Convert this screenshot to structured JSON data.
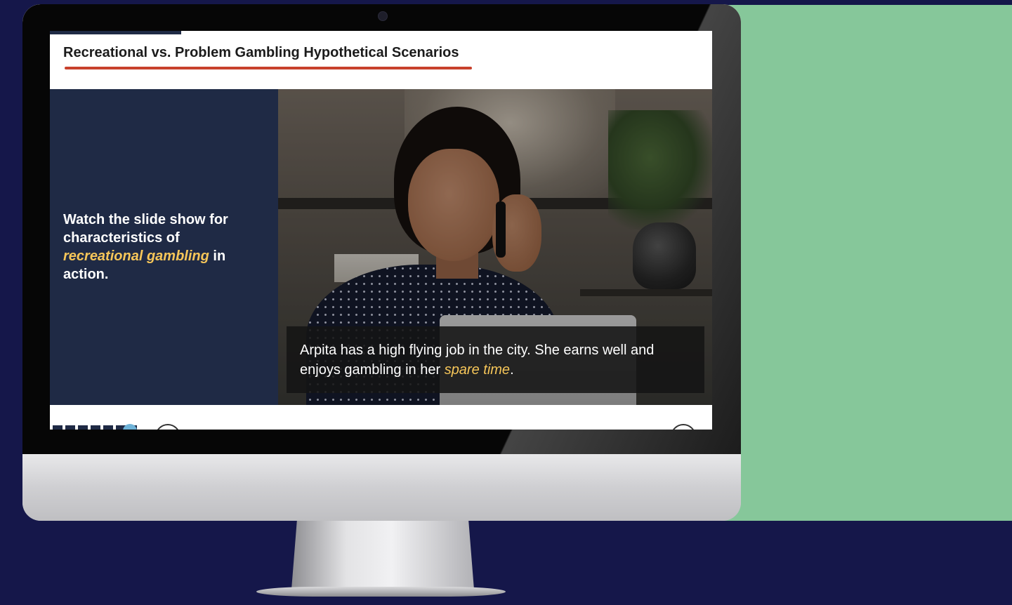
{
  "slide": {
    "title": "Recreational vs. Problem Gambling Hypothetical Scenarios",
    "instruction_part1": "Watch the slide show for characteristics of ",
    "instruction_highlight": "recreational gambling",
    "instruction_part2": " in action.",
    "caption_part1": "Arpita has a high flying job in the city. She earns well and enjoys gambling in her ",
    "caption_highlight": "spare time",
    "caption_part2": "."
  },
  "colors": {
    "accent_red": "#c8412c",
    "panel_navy": "#1f2a45",
    "highlight_yellow": "#f6c659",
    "background_navy": "#15174a",
    "side_green": "#86c79a"
  },
  "icons": {
    "prev": "circle-arrow-left-icon",
    "next": "circle-arrow-right-icon",
    "camera": "webcam-icon"
  }
}
